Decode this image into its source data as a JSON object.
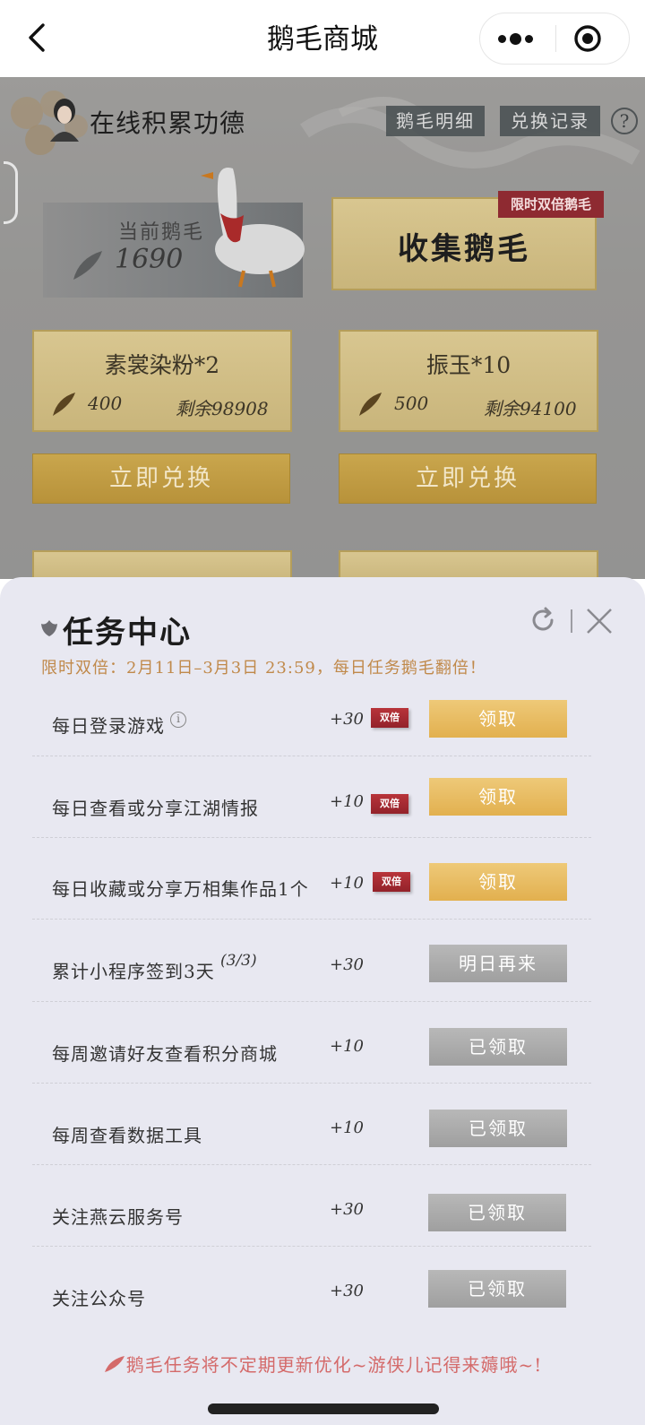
{
  "nav": {
    "title": "鹅毛商城"
  },
  "header": {
    "username": "在线积累功德",
    "detail_btn": "鹅毛明细",
    "record_btn": "兑换记录",
    "help": "?"
  },
  "balance": {
    "label": "当前鹅毛",
    "value": "1690"
  },
  "collect": {
    "label": "收集鹅毛",
    "tag": "限时双倍鹅毛"
  },
  "shop": {
    "items": [
      {
        "name": "素裳染粉*2",
        "cost": "400",
        "stock": "剩余98908",
        "button": "立即兑换"
      },
      {
        "name": "振玉*10",
        "cost": "500",
        "stock": "剩余94100",
        "button": "立即兑换"
      }
    ]
  },
  "tasks": {
    "title": "任务中心",
    "subtitle": "限时双倍：2月11日–3月3日 23:59，每日任务鹅毛翻倍！",
    "badge_text": "双倍",
    "info_glyph": "i",
    "rows": [
      {
        "label": "每日登录游戏",
        "points": "+30",
        "action": "领取"
      },
      {
        "label": "每日查看或分享江湖情报",
        "points": "+10",
        "action": "领取"
      },
      {
        "label": "每日收藏或分享万相集作品1个",
        "points": "+10",
        "action": "领取"
      },
      {
        "label": "累计小程序签到3天",
        "progress": "(3/3)",
        "points": "+30",
        "action": "明日再来"
      },
      {
        "label": "每周邀请好友查看积分商城",
        "points": "+10",
        "action": "已领取"
      },
      {
        "label": "每周查看数据工具",
        "points": "+10",
        "action": "已领取"
      },
      {
        "label": "关注燕云服务号",
        "points": "+30",
        "action": "已领取"
      },
      {
        "label": "关注公众号",
        "points": "+30",
        "action": "已领取"
      }
    ],
    "footer": "鹅毛任务将不定期更新优化~游侠儿记得来薅哦~!"
  },
  "colors": {
    "gold": "#e2b04f",
    "badge_red": "#a8262e",
    "subtitle": "#c0894a",
    "footer": "#d46a6a"
  }
}
